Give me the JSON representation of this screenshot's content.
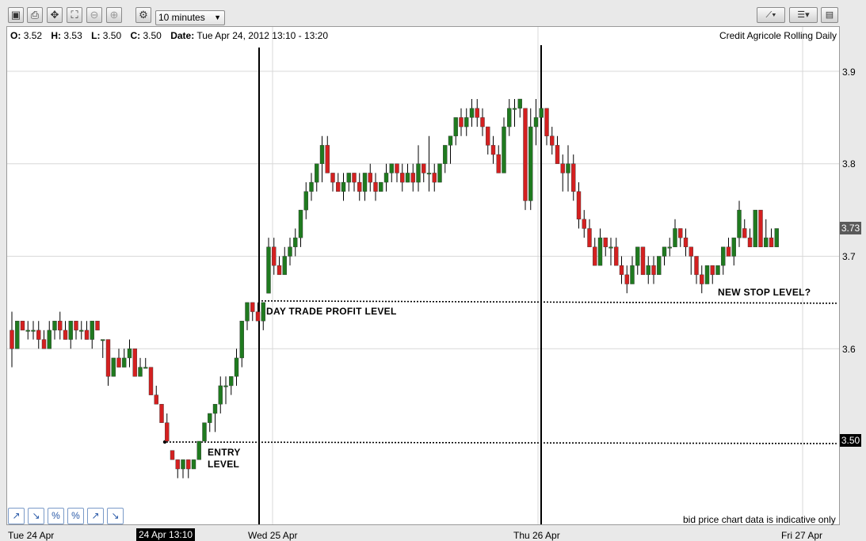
{
  "toolbar": {
    "buttons": [
      {
        "name": "chart-view-button",
        "icon": "monitor-icon",
        "glyph": "▣"
      },
      {
        "name": "print-button",
        "icon": "print-icon",
        "glyph": "⎙"
      },
      {
        "name": "pan-button",
        "icon": "move-icon",
        "glyph": "✥"
      },
      {
        "name": "fit-button",
        "icon": "fit-frame-icon",
        "glyph": "⛶"
      },
      {
        "name": "zoom-out-button",
        "icon": "zoom-out-icon",
        "glyph": "⊖"
      },
      {
        "name": "zoom-in-button",
        "icon": "zoom-in-icon",
        "glyph": "⊕"
      },
      {
        "name": "settings-button",
        "icon": "gear-icon",
        "glyph": "⚙"
      }
    ],
    "period": "10 minutes",
    "right_buttons": [
      {
        "name": "draw-line-menu-button",
        "icon": "line-tool-icon",
        "glyph": "⟋▾"
      },
      {
        "name": "chart-type-menu-button",
        "icon": "list-icon",
        "glyph": "☰▾"
      },
      {
        "name": "save-button",
        "icon": "save-icon",
        "glyph": "▤"
      }
    ]
  },
  "header": {
    "ohlc": {
      "o_label": "O:",
      "o": "3.52",
      "h_label": "H:",
      "h": "3.53",
      "l_label": "L:",
      "l": "3.50",
      "c_label": "C:",
      "c": "3.50"
    },
    "date_label": "Date:",
    "date": "Tue Apr 24, 2012 13:10 - 13:20",
    "title": "Credit Agricole Rolling Daily"
  },
  "footer_note": "bid price chart data is indicative only",
  "drawing_tools": [
    {
      "name": "trend-up-tool",
      "icon": "arrow-up-right-icon",
      "glyph": "↗"
    },
    {
      "name": "trend-down-tool",
      "icon": "arrow-down-right-icon",
      "glyph": "↘"
    },
    {
      "name": "percent-up-tool",
      "icon": "percent-up-icon",
      "glyph": "%"
    },
    {
      "name": "percent-down-tool",
      "icon": "percent-down-icon",
      "glyph": "%"
    },
    {
      "name": "ray-up-tool",
      "icon": "ray-up-icon",
      "glyph": "↗"
    },
    {
      "name": "ray-down-tool",
      "icon": "ray-down-icon",
      "glyph": "↘"
    }
  ],
  "colors": {
    "up": "#1f7a1f",
    "down": "#d42020",
    "grid": "#d8d8d8",
    "wick": "#000000"
  },
  "chart_data": {
    "type": "candlestick",
    "instrument": "Credit Agricole Rolling Daily",
    "interval": "10 minutes",
    "ylim": [
      3.42,
      3.93
    ],
    "y_ticks": [
      3.6,
      3.7,
      3.8,
      3.9
    ],
    "y_tick_labels": [
      "3.6",
      "3.7",
      "3.8",
      "3.9"
    ],
    "x_labels": [
      "Tue 24 Apr",
      "24 Apr 13:10",
      "Wed 25 Apr",
      "Thu 26 Apr",
      "Fri 27 Apr"
    ],
    "current_price": "3.73",
    "marked_price": "3.50",
    "grid": true,
    "day_separators": [
      "Wed 25 Apr",
      "Thu 26 Apr"
    ],
    "horizontal_levels": [
      {
        "price": 3.65,
        "label": "DAY TRADE PROFIT LEVEL"
      },
      {
        "price": 3.5,
        "label": "ENTRY\nLEVEL"
      },
      {
        "price": 3.65,
        "label": "NEW STOP LEVEL?"
      }
    ],
    "candles": [
      [
        3.62,
        3.64,
        3.58,
        3.6
      ],
      [
        3.6,
        3.63,
        3.6,
        3.63
      ],
      [
        3.63,
        3.63,
        3.62,
        3.62
      ],
      [
        3.62,
        3.63,
        3.61,
        3.62
      ],
      [
        3.62,
        3.63,
        3.61,
        3.62
      ],
      [
        3.62,
        3.63,
        3.6,
        3.61
      ],
      [
        3.61,
        3.62,
        3.6,
        3.6
      ],
      [
        3.6,
        3.63,
        3.6,
        3.62
      ],
      [
        3.62,
        3.63,
        3.61,
        3.63
      ],
      [
        3.63,
        3.64,
        3.61,
        3.62
      ],
      [
        3.62,
        3.63,
        3.61,
        3.61
      ],
      [
        3.61,
        3.63,
        3.6,
        3.63
      ],
      [
        3.63,
        3.63,
        3.61,
        3.62
      ],
      [
        3.62,
        3.63,
        3.61,
        3.62
      ],
      [
        3.62,
        3.63,
        3.61,
        3.61
      ],
      [
        3.61,
        3.63,
        3.6,
        3.63
      ],
      [
        3.63,
        3.63,
        3.62,
        3.62
      ],
      [
        3.61,
        3.61,
        3.59,
        3.61
      ],
      [
        3.61,
        3.61,
        3.56,
        3.57
      ],
      [
        3.57,
        3.59,
        3.57,
        3.59
      ],
      [
        3.59,
        3.6,
        3.58,
        3.58
      ],
      [
        3.58,
        3.6,
        3.58,
        3.59
      ],
      [
        3.59,
        3.61,
        3.58,
        3.6
      ],
      [
        3.6,
        3.6,
        3.57,
        3.57
      ],
      [
        3.57,
        3.59,
        3.57,
        3.58
      ],
      [
        3.58,
        3.59,
        3.58,
        3.58
      ],
      [
        3.58,
        3.58,
        3.55,
        3.55
      ],
      [
        3.55,
        3.56,
        3.54,
        3.54
      ],
      [
        3.54,
        3.54,
        3.52,
        3.52
      ],
      [
        3.52,
        3.53,
        3.5,
        3.5
      ],
      [
        3.49,
        3.49,
        3.48,
        3.48
      ],
      [
        3.48,
        3.48,
        3.46,
        3.47
      ],
      [
        3.47,
        3.48,
        3.46,
        3.48
      ],
      [
        3.48,
        3.48,
        3.46,
        3.47
      ],
      [
        3.47,
        3.48,
        3.47,
        3.48
      ],
      [
        3.48,
        3.5,
        3.48,
        3.5
      ],
      [
        3.5,
        3.52,
        3.5,
        3.52
      ],
      [
        3.52,
        3.53,
        3.51,
        3.53
      ],
      [
        3.53,
        3.54,
        3.51,
        3.54
      ],
      [
        3.54,
        3.57,
        3.53,
        3.56
      ],
      [
        3.56,
        3.57,
        3.54,
        3.56
      ],
      [
        3.56,
        3.57,
        3.55,
        3.57
      ],
      [
        3.57,
        3.6,
        3.56,
        3.59
      ],
      [
        3.59,
        3.63,
        3.58,
        3.63
      ],
      [
        3.63,
        3.65,
        3.62,
        3.65
      ],
      [
        3.65,
        3.65,
        3.63,
        3.64
      ],
      [
        3.64,
        3.65,
        3.63,
        3.63
      ],
      [
        3.63,
        3.65,
        3.62,
        3.65
      ],
      [
        3.66,
        3.72,
        3.66,
        3.71
      ],
      [
        3.71,
        3.72,
        3.68,
        3.69
      ],
      [
        3.69,
        3.7,
        3.68,
        3.68
      ],
      [
        3.68,
        3.71,
        3.68,
        3.7
      ],
      [
        3.7,
        3.72,
        3.69,
        3.71
      ],
      [
        3.71,
        3.73,
        3.7,
        3.72
      ],
      [
        3.72,
        3.75,
        3.71,
        3.75
      ],
      [
        3.75,
        3.78,
        3.74,
        3.77
      ],
      [
        3.77,
        3.79,
        3.76,
        3.78
      ],
      [
        3.78,
        3.8,
        3.77,
        3.8
      ],
      [
        3.8,
        3.83,
        3.78,
        3.82
      ],
      [
        3.82,
        3.83,
        3.79,
        3.79
      ],
      [
        3.79,
        3.79,
        3.77,
        3.78
      ],
      [
        3.78,
        3.79,
        3.77,
        3.77
      ],
      [
        3.77,
        3.79,
        3.76,
        3.78
      ],
      [
        3.78,
        3.79,
        3.77,
        3.79
      ],
      [
        3.79,
        3.79,
        3.77,
        3.78
      ],
      [
        3.78,
        3.79,
        3.76,
        3.77
      ],
      [
        3.77,
        3.79,
        3.76,
        3.79
      ],
      [
        3.79,
        3.8,
        3.77,
        3.78
      ],
      [
        3.78,
        3.79,
        3.76,
        3.77
      ],
      [
        3.77,
        3.78,
        3.77,
        3.78
      ],
      [
        3.78,
        3.8,
        3.77,
        3.79
      ],
      [
        3.79,
        3.8,
        3.78,
        3.8
      ],
      [
        3.8,
        3.8,
        3.78,
        3.79
      ],
      [
        3.79,
        3.8,
        3.77,
        3.78
      ],
      [
        3.78,
        3.8,
        3.78,
        3.79
      ],
      [
        3.79,
        3.8,
        3.77,
        3.78
      ],
      [
        3.78,
        3.82,
        3.77,
        3.8
      ],
      [
        3.8,
        3.8,
        3.78,
        3.79
      ],
      [
        3.79,
        3.83,
        3.77,
        3.79
      ],
      [
        3.79,
        3.8,
        3.77,
        3.78
      ],
      [
        3.78,
        3.8,
        3.78,
        3.8
      ],
      [
        3.8,
        3.82,
        3.79,
        3.82
      ],
      [
        3.82,
        3.83,
        3.8,
        3.83
      ],
      [
        3.83,
        3.85,
        3.82,
        3.85
      ],
      [
        3.85,
        3.86,
        3.83,
        3.84
      ],
      [
        3.84,
        3.86,
        3.83,
        3.85
      ],
      [
        3.85,
        3.87,
        3.84,
        3.86
      ],
      [
        3.86,
        3.87,
        3.84,
        3.85
      ],
      [
        3.85,
        3.86,
        3.83,
        3.84
      ],
      [
        3.84,
        3.84,
        3.81,
        3.82
      ],
      [
        3.82,
        3.83,
        3.8,
        3.81
      ],
      [
        3.81,
        3.82,
        3.79,
        3.79
      ],
      [
        3.79,
        3.85,
        3.79,
        3.84
      ],
      [
        3.84,
        3.87,
        3.83,
        3.86
      ],
      [
        3.86,
        3.87,
        3.84,
        3.86
      ],
      [
        3.86,
        3.87,
        3.85,
        3.87
      ],
      [
        3.86,
        3.86,
        3.75,
        3.76
      ],
      [
        3.76,
        3.86,
        3.75,
        3.84
      ],
      [
        3.84,
        3.87,
        3.82,
        3.85
      ],
      [
        3.85,
        3.88,
        3.84,
        3.86
      ],
      [
        3.86,
        3.86,
        3.82,
        3.83
      ],
      [
        3.83,
        3.84,
        3.81,
        3.82
      ],
      [
        3.82,
        3.83,
        3.8,
        3.8
      ],
      [
        3.8,
        3.81,
        3.77,
        3.79
      ],
      [
        3.79,
        3.82,
        3.77,
        3.8
      ],
      [
        3.8,
        3.81,
        3.76,
        3.77
      ],
      [
        3.77,
        3.78,
        3.73,
        3.74
      ],
      [
        3.74,
        3.75,
        3.72,
        3.73
      ],
      [
        3.73,
        3.74,
        3.71,
        3.71
      ],
      [
        3.71,
        3.72,
        3.69,
        3.69
      ],
      [
        3.69,
        3.73,
        3.69,
        3.72
      ],
      [
        3.72,
        3.72,
        3.7,
        3.71
      ],
      [
        3.71,
        3.72,
        3.69,
        3.71
      ],
      [
        3.71,
        3.72,
        3.69,
        3.69
      ],
      [
        3.69,
        3.7,
        3.67,
        3.68
      ],
      [
        3.68,
        3.69,
        3.66,
        3.67
      ],
      [
        3.67,
        3.7,
        3.67,
        3.69
      ],
      [
        3.69,
        3.71,
        3.68,
        3.71
      ],
      [
        3.71,
        3.71,
        3.68,
        3.68
      ],
      [
        3.68,
        3.7,
        3.67,
        3.69
      ],
      [
        3.69,
        3.7,
        3.67,
        3.68
      ],
      [
        3.68,
        3.7,
        3.68,
        3.7
      ],
      [
        3.7,
        3.71,
        3.69,
        3.71
      ],
      [
        3.71,
        3.72,
        3.7,
        3.71
      ],
      [
        3.71,
        3.74,
        3.71,
        3.73
      ],
      [
        3.73,
        3.73,
        3.71,
        3.72
      ],
      [
        3.72,
        3.73,
        3.7,
        3.71
      ],
      [
        3.71,
        3.71,
        3.68,
        3.7
      ],
      [
        3.7,
        3.7,
        3.67,
        3.68
      ],
      [
        3.68,
        3.69,
        3.66,
        3.67
      ],
      [
        3.67,
        3.69,
        3.67,
        3.69
      ],
      [
        3.69,
        3.69,
        3.67,
        3.68
      ],
      [
        3.68,
        3.69,
        3.68,
        3.69
      ],
      [
        3.69,
        3.71,
        3.68,
        3.71
      ],
      [
        3.71,
        3.72,
        3.7,
        3.7
      ],
      [
        3.7,
        3.72,
        3.69,
        3.72
      ],
      [
        3.72,
        3.76,
        3.71,
        3.75
      ],
      [
        3.73,
        3.74,
        3.72,
        3.72
      ],
      [
        3.72,
        3.73,
        3.71,
        3.71
      ],
      [
        3.71,
        3.75,
        3.71,
        3.75
      ],
      [
        3.75,
        3.75,
        3.71,
        3.71
      ],
      [
        3.71,
        3.74,
        3.71,
        3.72
      ],
      [
        3.72,
        3.73,
        3.71,
        3.71
      ],
      [
        3.71,
        3.73,
        3.71,
        3.73
      ]
    ]
  }
}
